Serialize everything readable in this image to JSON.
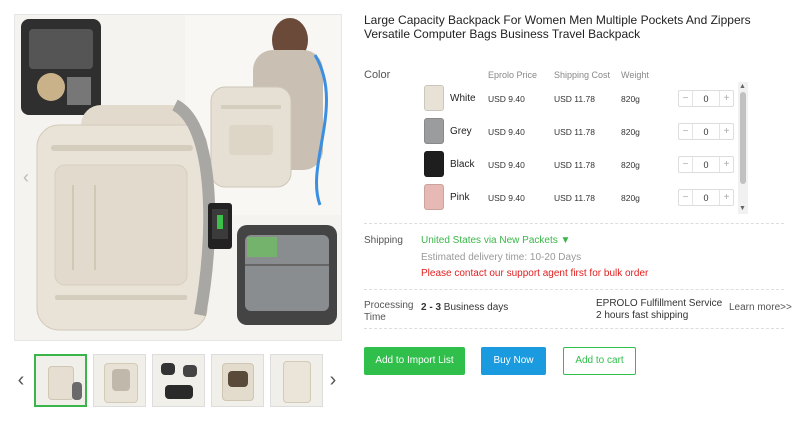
{
  "product": {
    "title": "Large Capacity Backpack For Women Men Multiple Pockets And Zippers Versatile Computer Bags Business Travel Backpack"
  },
  "gallery": {
    "prev_icon": "chevron-left-icon",
    "next_icon": "chevron-right-icon",
    "prev_glyph": "‹",
    "next_glyph": "›",
    "thumbnail_count": 5,
    "active_thumbnail": 1
  },
  "variants": {
    "label": "Color",
    "headers": {
      "price": "Eprolo Price",
      "shipping": "Shipping Cost",
      "weight": "Weight"
    },
    "items": [
      {
        "name": "White",
        "price": "USD 9.40",
        "shipping": "USD 11.78",
        "weight": "820g",
        "qty": "0",
        "color": "#e8e2d6"
      },
      {
        "name": "Grey",
        "price": "USD 9.40",
        "shipping": "USD 11.78",
        "weight": "820g",
        "qty": "0",
        "color": "#9a9c9e"
      },
      {
        "name": "Black",
        "price": "USD 9.40",
        "shipping": "USD 11.78",
        "weight": "820g",
        "qty": "0",
        "color": "#1e1e1e"
      },
      {
        "name": "Pink",
        "price": "USD 9.40",
        "shipping": "USD 11.78",
        "weight": "820g",
        "qty": "0",
        "color": "#e7b9b4"
      }
    ],
    "minus": "−",
    "plus": "+"
  },
  "shipping": {
    "label": "Shipping",
    "method": "United States via New Packets ▼",
    "estimate": "Estimated delivery time: 10-20 Days",
    "warning": "Please contact our support agent first for bulk order"
  },
  "processing": {
    "label": "Processing Time",
    "days_bold": "2 - 3",
    "days_rest": " Business days",
    "service_line1": "EPROLO Fulfillment Service",
    "service_line2": "2 hours fast shipping",
    "learn_more": "Learn more>>"
  },
  "actions": {
    "import": "Add to Import List",
    "buy": "Buy Now",
    "cart": "Add to cart"
  },
  "colors": {
    "accent_green": "#2fbf4a",
    "accent_blue": "#1a9be0",
    "warning_red": "#e02020"
  }
}
